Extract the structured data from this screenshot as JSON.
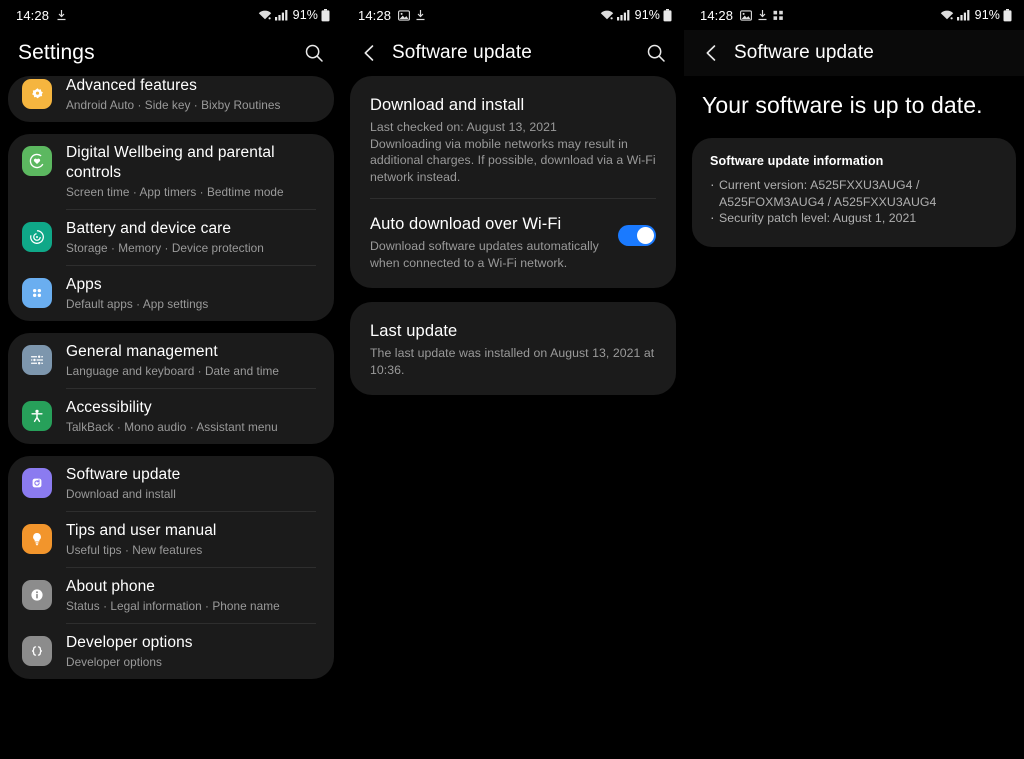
{
  "statusbar": {
    "time": "14:28",
    "battery": "91%",
    "left_icons_panel1": [
      "download-icon"
    ],
    "left_icons_panel2": [
      "image-icon",
      "download-icon"
    ],
    "left_icons_panel3": [
      "image-icon",
      "download-icon",
      "grid-dots-icon"
    ],
    "right_icons": [
      "wifi-icon",
      "signal-icon",
      "battery-icon"
    ]
  },
  "panel_settings": {
    "title": "Settings",
    "search_icon": "search-icon",
    "groups": [
      {
        "clipped": true,
        "rows": [
          {
            "title": "Advanced features",
            "subtitle": "Android Auto  ·  Side key  ·  Bixby Routines",
            "icon": "advanced-features-icon",
            "icon_color": "#f5b53f"
          }
        ]
      },
      {
        "clipped": false,
        "rows": [
          {
            "title": "Digital Wellbeing and parental controls",
            "subtitle": "Screen time  ·  App timers  ·  Bedtime mode",
            "icon": "digital-wellbeing-icon",
            "icon_color": "#5cb860"
          },
          {
            "title": "Battery and device care",
            "subtitle": "Storage  ·  Memory  ·  Device protection",
            "icon": "battery-device-care-icon",
            "icon_color": "#0fa888"
          },
          {
            "title": "Apps",
            "subtitle": "Default apps  ·  App settings",
            "icon": "apps-icon",
            "icon_color": "#6aaef0"
          }
        ]
      },
      {
        "clipped": false,
        "rows": [
          {
            "title": "General management",
            "subtitle": "Language and keyboard  ·  Date and time",
            "icon": "general-management-icon",
            "icon_color": "#7d96ad"
          },
          {
            "title": "Accessibility",
            "subtitle": "TalkBack  ·  Mono audio  ·  Assistant menu",
            "icon": "accessibility-icon",
            "icon_color": "#27a05a"
          }
        ]
      },
      {
        "clipped": false,
        "rows": [
          {
            "title": "Software update",
            "subtitle": "Download and install",
            "icon": "software-update-icon",
            "icon_color": "#8b7bf0"
          },
          {
            "title": "Tips and user manual",
            "subtitle": "Useful tips  ·  New features",
            "icon": "tips-icon",
            "icon_color": "#f2952c"
          },
          {
            "title": "About phone",
            "subtitle": "Status  ·  Legal information  ·  Phone name",
            "icon": "about-phone-icon",
            "icon_color": "#8c8c8c"
          },
          {
            "title": "Developer options",
            "subtitle": "Developer options",
            "icon": "developer-options-icon",
            "icon_color": "#8c8c8c"
          }
        ]
      }
    ]
  },
  "panel_update": {
    "title": "Software update",
    "back_icon": "back-chevron-icon",
    "search_icon": "search-icon",
    "download_install": {
      "title": "Download and install",
      "last_checked": "Last checked on: August 13, 2021",
      "description": "Downloading via mobile networks may result in additional charges. If possible, download via a Wi-Fi network instead."
    },
    "auto_download": {
      "title": "Auto download over Wi-Fi",
      "description": "Download software updates automatically when connected to a Wi-Fi network.",
      "toggle_on": true,
      "toggle_color": "#1a7aff"
    },
    "last_update": {
      "title": "Last update",
      "description": "The last update was installed on August 13, 2021 at 10:36."
    }
  },
  "panel_uptodate": {
    "title": "Software update",
    "back_icon": "back-chevron-icon",
    "headline": "Your software is up to date.",
    "info_heading": "Software update information",
    "info_items": [
      {
        "line1": "Current version: A525FXXU3AUG4 /",
        "line2": "A525FOXM3AUG4 / A525FXXU3AUG4"
      },
      {
        "line1": "Security patch level: August 1, 2021",
        "line2": ""
      }
    ]
  }
}
